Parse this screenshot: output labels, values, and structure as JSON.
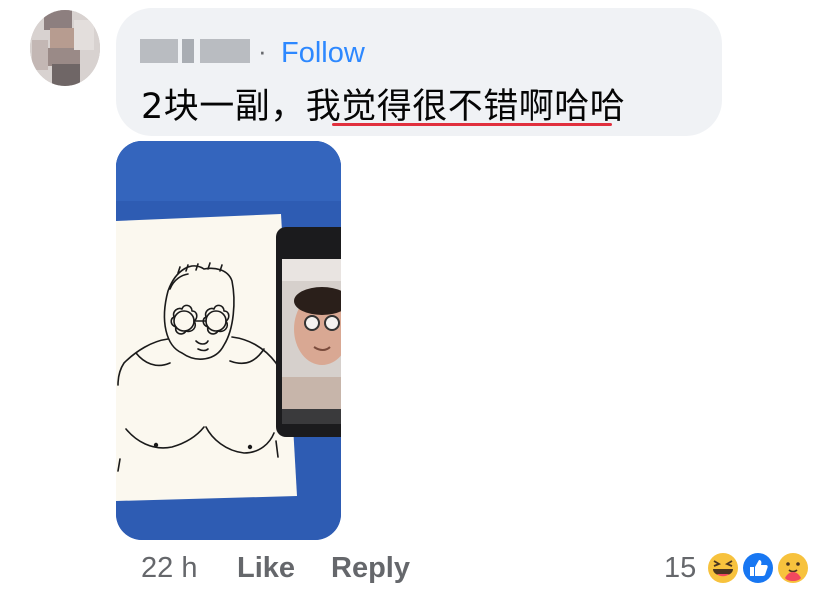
{
  "comment": {
    "author_display": "",
    "separator": "·",
    "follow_label": "Follow",
    "text": "2块一副，我觉得很不错啊哈哈"
  },
  "actions": {
    "time": "22 h",
    "like_label": "Like",
    "reply_label": "Reply",
    "reaction_count": "15"
  },
  "reactions": [
    "haha-icon",
    "like-icon",
    "care-icon"
  ],
  "colors": {
    "bubble": "#f0f2f5",
    "link": "#2d88ff",
    "meta_text": "#65676b",
    "spellcheck": "#e1303e",
    "photo_background": "#2d5db5"
  }
}
